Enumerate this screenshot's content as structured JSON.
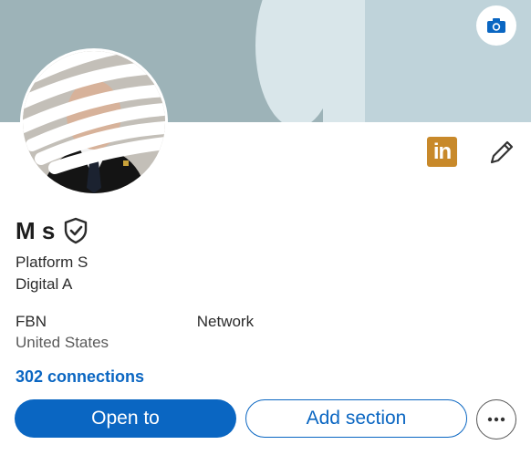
{
  "banner": {
    "camera_icon": "camera-icon"
  },
  "profile": {
    "linkedin_badge": "in",
    "name": "M          s",
    "headline_line1": "Platform S",
    "headline_line2": "Digital A",
    "location_prefix": "FBN ",
    "location_suffix": "Network",
    "country": "United States",
    "connections": "302 connections"
  },
  "actions": {
    "open_to": "Open to",
    "add_section": "Add section",
    "more_icon": "more-icon"
  },
  "colors": {
    "accent": "#0a66c2",
    "linkedin_badge": "#c8892a"
  }
}
